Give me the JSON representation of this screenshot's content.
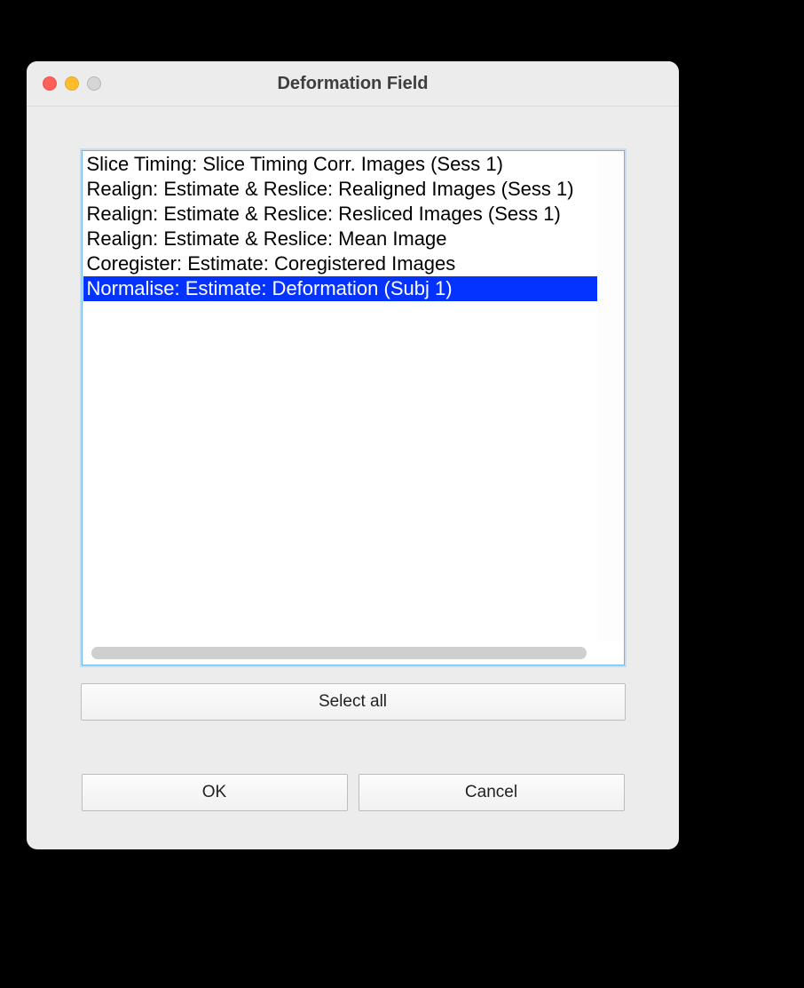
{
  "window": {
    "title": "Deformation Field"
  },
  "list": {
    "items": [
      {
        "label": "Slice Timing: Slice Timing Corr. Images (Sess 1)",
        "selected": false
      },
      {
        "label": "Realign: Estimate & Reslice: Realigned Images (Sess 1)",
        "selected": false
      },
      {
        "label": "Realign: Estimate & Reslice: Resliced Images (Sess 1)",
        "selected": false
      },
      {
        "label": "Realign: Estimate & Reslice: Mean Image",
        "selected": false
      },
      {
        "label": "Coregister: Estimate: Coregistered Images",
        "selected": false
      },
      {
        "label": "Normalise: Estimate: Deformation (Subj 1)",
        "selected": true
      }
    ]
  },
  "buttons": {
    "select_all": "Select all",
    "ok": "OK",
    "cancel": "Cancel"
  }
}
